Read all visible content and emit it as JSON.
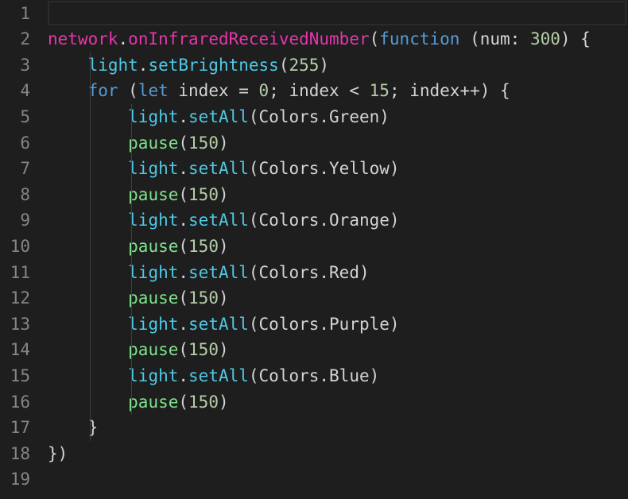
{
  "editor": {
    "lines": [
      {
        "number": "1",
        "tokens": []
      },
      {
        "number": "2",
        "tokens": [
          {
            "text": "network",
            "cls": "t-mag"
          },
          {
            "text": ".",
            "cls": "t-txt"
          },
          {
            "text": "onInfraredReceivedNumber",
            "cls": "t-mag"
          },
          {
            "text": "(",
            "cls": "t-txt"
          },
          {
            "text": "function",
            "cls": "t-blue"
          },
          {
            "text": " (num: ",
            "cls": "t-txt"
          },
          {
            "text": "300",
            "cls": "t-num"
          },
          {
            "text": ") {",
            "cls": "t-txt"
          }
        ]
      },
      {
        "number": "3",
        "tokens": [
          {
            "text": "    ",
            "cls": "t-txt"
          },
          {
            "text": "light",
            "cls": "t-cyan"
          },
          {
            "text": ".",
            "cls": "t-txt"
          },
          {
            "text": "setBrightness",
            "cls": "t-cyan"
          },
          {
            "text": "(",
            "cls": "t-txt"
          },
          {
            "text": "255",
            "cls": "t-num"
          },
          {
            "text": ")",
            "cls": "t-txt"
          }
        ]
      },
      {
        "number": "4",
        "tokens": [
          {
            "text": "    ",
            "cls": "t-txt"
          },
          {
            "text": "for",
            "cls": "t-blue"
          },
          {
            "text": " (",
            "cls": "t-txt"
          },
          {
            "text": "let",
            "cls": "t-blue"
          },
          {
            "text": " index = ",
            "cls": "t-txt"
          },
          {
            "text": "0",
            "cls": "t-num"
          },
          {
            "text": "; index < ",
            "cls": "t-txt"
          },
          {
            "text": "15",
            "cls": "t-num"
          },
          {
            "text": "; index++) {",
            "cls": "t-txt"
          }
        ]
      },
      {
        "number": "5",
        "tokens": [
          {
            "text": "        ",
            "cls": "t-txt"
          },
          {
            "text": "light",
            "cls": "t-cyan"
          },
          {
            "text": ".",
            "cls": "t-txt"
          },
          {
            "text": "setAll",
            "cls": "t-cyan"
          },
          {
            "text": "(Colors.Green)",
            "cls": "t-txt"
          }
        ]
      },
      {
        "number": "6",
        "tokens": [
          {
            "text": "        ",
            "cls": "t-txt"
          },
          {
            "text": "pause",
            "cls": "t-grn"
          },
          {
            "text": "(",
            "cls": "t-txt"
          },
          {
            "text": "150",
            "cls": "t-num"
          },
          {
            "text": ")",
            "cls": "t-txt"
          }
        ]
      },
      {
        "number": "7",
        "tokens": [
          {
            "text": "        ",
            "cls": "t-txt"
          },
          {
            "text": "light",
            "cls": "t-cyan"
          },
          {
            "text": ".",
            "cls": "t-txt"
          },
          {
            "text": "setAll",
            "cls": "t-cyan"
          },
          {
            "text": "(Colors.Yellow)",
            "cls": "t-txt"
          }
        ]
      },
      {
        "number": "8",
        "tokens": [
          {
            "text": "        ",
            "cls": "t-txt"
          },
          {
            "text": "pause",
            "cls": "t-grn"
          },
          {
            "text": "(",
            "cls": "t-txt"
          },
          {
            "text": "150",
            "cls": "t-num"
          },
          {
            "text": ")",
            "cls": "t-txt"
          }
        ]
      },
      {
        "number": "9",
        "tokens": [
          {
            "text": "        ",
            "cls": "t-txt"
          },
          {
            "text": "light",
            "cls": "t-cyan"
          },
          {
            "text": ".",
            "cls": "t-txt"
          },
          {
            "text": "setAll",
            "cls": "t-cyan"
          },
          {
            "text": "(Colors.Orange)",
            "cls": "t-txt"
          }
        ]
      },
      {
        "number": "10",
        "tokens": [
          {
            "text": "        ",
            "cls": "t-txt"
          },
          {
            "text": "pause",
            "cls": "t-grn"
          },
          {
            "text": "(",
            "cls": "t-txt"
          },
          {
            "text": "150",
            "cls": "t-num"
          },
          {
            "text": ")",
            "cls": "t-txt"
          }
        ]
      },
      {
        "number": "11",
        "tokens": [
          {
            "text": "        ",
            "cls": "t-txt"
          },
          {
            "text": "light",
            "cls": "t-cyan"
          },
          {
            "text": ".",
            "cls": "t-txt"
          },
          {
            "text": "setAll",
            "cls": "t-cyan"
          },
          {
            "text": "(Colors.Red)",
            "cls": "t-txt"
          }
        ]
      },
      {
        "number": "12",
        "tokens": [
          {
            "text": "        ",
            "cls": "t-txt"
          },
          {
            "text": "pause",
            "cls": "t-grn"
          },
          {
            "text": "(",
            "cls": "t-txt"
          },
          {
            "text": "150",
            "cls": "t-num"
          },
          {
            "text": ")",
            "cls": "t-txt"
          }
        ]
      },
      {
        "number": "13",
        "tokens": [
          {
            "text": "        ",
            "cls": "t-txt"
          },
          {
            "text": "light",
            "cls": "t-cyan"
          },
          {
            "text": ".",
            "cls": "t-txt"
          },
          {
            "text": "setAll",
            "cls": "t-cyan"
          },
          {
            "text": "(Colors.Purple)",
            "cls": "t-txt"
          }
        ]
      },
      {
        "number": "14",
        "tokens": [
          {
            "text": "        ",
            "cls": "t-txt"
          },
          {
            "text": "pause",
            "cls": "t-grn"
          },
          {
            "text": "(",
            "cls": "t-txt"
          },
          {
            "text": "150",
            "cls": "t-num"
          },
          {
            "text": ")",
            "cls": "t-txt"
          }
        ]
      },
      {
        "number": "15",
        "tokens": [
          {
            "text": "        ",
            "cls": "t-txt"
          },
          {
            "text": "light",
            "cls": "t-cyan"
          },
          {
            "text": ".",
            "cls": "t-txt"
          },
          {
            "text": "setAll",
            "cls": "t-cyan"
          },
          {
            "text": "(Colors.Blue)",
            "cls": "t-txt"
          }
        ]
      },
      {
        "number": "16",
        "tokens": [
          {
            "text": "        ",
            "cls": "t-txt"
          },
          {
            "text": "pause",
            "cls": "t-grn"
          },
          {
            "text": "(",
            "cls": "t-txt"
          },
          {
            "text": "150",
            "cls": "t-num"
          },
          {
            "text": ")",
            "cls": "t-txt"
          }
        ]
      },
      {
        "number": "17",
        "tokens": [
          {
            "text": "    }",
            "cls": "t-txt"
          }
        ]
      },
      {
        "number": "18",
        "tokens": [
          {
            "text": "})",
            "cls": "t-txt"
          }
        ]
      },
      {
        "number": "19",
        "tokens": []
      }
    ]
  }
}
